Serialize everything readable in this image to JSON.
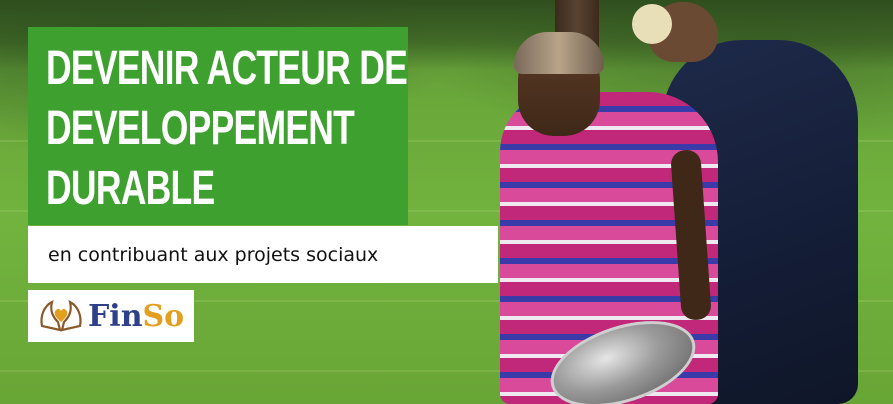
{
  "headline": {
    "lines": [
      "DEVENIR ACTEUR DE",
      "DEVELOPPEMENT",
      "DURABLE"
    ]
  },
  "subtitle": "en contribuant aux projets sociaux",
  "logo": {
    "icon": "hands-heart-icon",
    "text_main": "Fin",
    "text_accent": "So"
  },
  "colors": {
    "headline_bg": "#3ea12f",
    "headline_text": "#ffffff",
    "subtitle_bg": "#ffffff",
    "logo_blue": "#2f3f8a",
    "logo_gold": "#e3a020"
  }
}
